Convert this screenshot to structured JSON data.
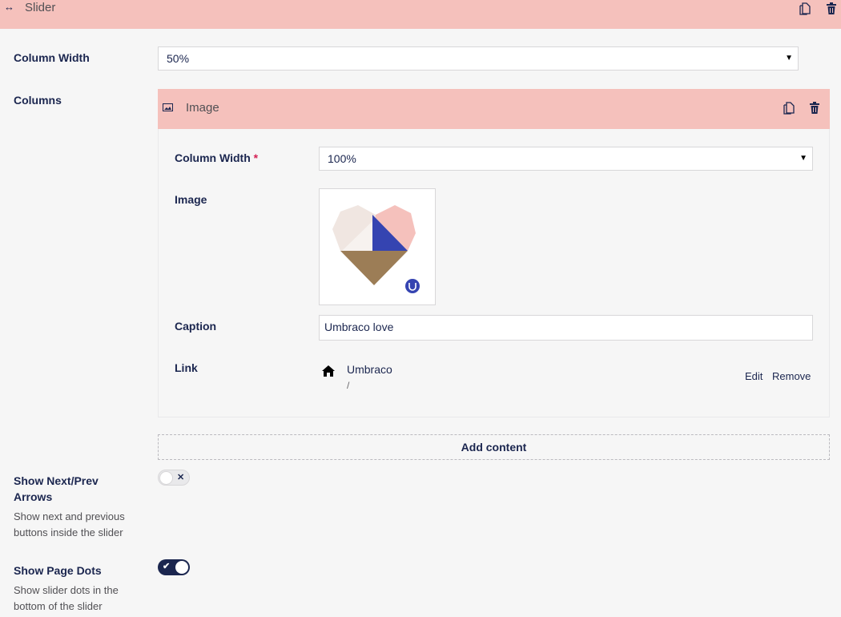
{
  "block": {
    "title": "Slider",
    "drag_icon": "↔",
    "icons": [
      "copy-icon",
      "trash-icon"
    ]
  },
  "fields": {
    "column_width": {
      "label": "Column Width",
      "value": "50%"
    },
    "columns": {
      "label": "Columns"
    }
  },
  "image_block": {
    "title": "Image",
    "column_width": {
      "label": "Column Width",
      "required_mark": "*",
      "value": "100%"
    },
    "image": {
      "label": "Image"
    },
    "caption": {
      "label": "Caption",
      "value": "Umbraco love"
    },
    "link": {
      "label": "Link",
      "name": "Umbraco",
      "url": "/",
      "edit": "Edit",
      "remove": "Remove"
    }
  },
  "add_content": "Add content",
  "arrows": {
    "label_line1": "Show Next/Prev",
    "label_line2": "Arrows",
    "desc_line1": "Show next and previous",
    "desc_line2": "buttons inside the slider",
    "enabled": false
  },
  "dots": {
    "label": "Show Page Dots",
    "desc_line1": "Show slider dots in the",
    "desc_line2": "bottom of the slider",
    "enabled": true
  },
  "colors": {
    "block_header": "#f5c1bc",
    "accent": "#1b264f",
    "heart_brown": "#9c7d56",
    "heart_blue": "#3544b1"
  }
}
